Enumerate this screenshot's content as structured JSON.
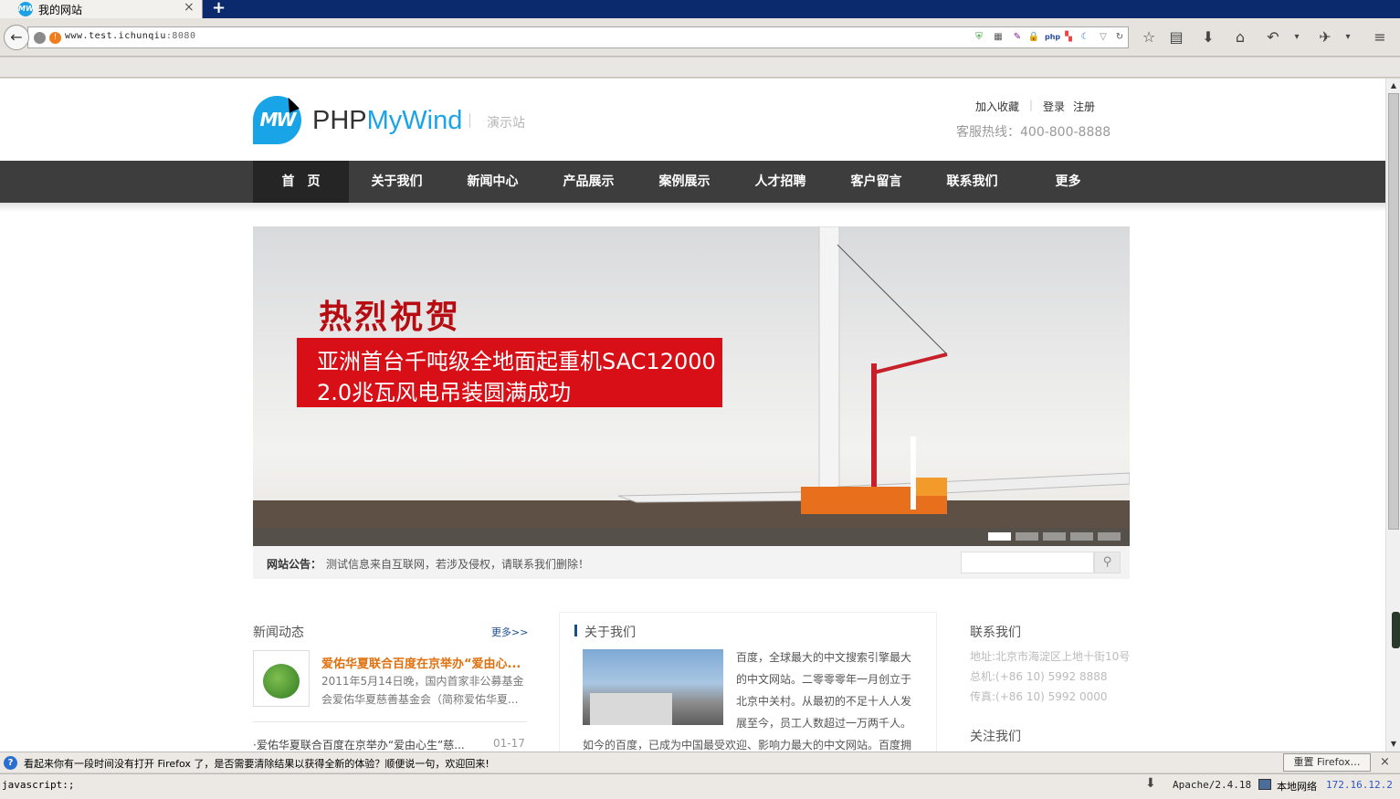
{
  "browser": {
    "tab_title": "我的网站",
    "tab_close": "×",
    "new_tab": "+",
    "url_host": "www.test.ichunqiu",
    "url_port": ":8080",
    "back": "←"
  },
  "site": {
    "logo_mark": "MW",
    "logo_php": "PHP",
    "logo_mywind": "MyWind",
    "logo_demo": "演示站",
    "top_links": [
      "加入收藏",
      "登录",
      "注册"
    ],
    "hotline": "客服热线：400-800-8888"
  },
  "nav": [
    "首　页",
    "关于我们",
    "新闻中心",
    "产品展示",
    "案例展示",
    "人才招聘",
    "客户留言",
    "联系我们",
    "更多"
  ],
  "banner": {
    "headline": "热烈祝贺",
    "line1": "亚洲首台千吨级全地面起重机SAC12000",
    "line2": "2.0兆瓦风电吊装圆满成功",
    "slide_count": 5,
    "active_slide": 1
  },
  "notice": {
    "label": "网站公告：",
    "text": "测试信息来自互联网，若涉及侵权，请联系我们删除！",
    "search_placeholder": ""
  },
  "news": {
    "title": "新闻动态",
    "more": "更多>>",
    "featured_title": "爱佑华夏联合百度在京举办“爱由心...",
    "featured_desc_1": "2011年5月14日晚，国内首家非公募基金",
    "featured_desc_2": "会爱佑华夏慈善基金会（简称爱佑华夏...",
    "items": [
      {
        "title": "·爱佑华夏联合百度在京举办“爱由心生”慈...",
        "date": "01-17"
      }
    ]
  },
  "about": {
    "title": "关于我们",
    "lines": [
      "百度，全球最大的中文搜索引擎最大",
      "的中文网站。二零零零年一月创立于",
      "北京中关村。从最初的不足十人人发",
      "展至今，员工人数超过一万两千人。"
    ],
    "line_full": "如今的百度，已成为中国最受欢迎、影响力最大的中文网站。百度拥"
  },
  "contact": {
    "title": "联系我们",
    "address": "地址:北京市海淀区上地十街10号",
    "phone": "总机:(+86 10) 5992 8888",
    "fax": "传真:(+86 10) 5992 0000",
    "follow": "关注我们"
  },
  "notification": {
    "message": "看起来你有一段时间没有打开 Firefox 了，是否需要清除结果以获得全新的体验？顺便说一句，欢迎回来!",
    "reset_button": "重置 Firefox…",
    "close": "×"
  },
  "statusbar": {
    "left": "javascript:;",
    "server": "Apache/2.4.18",
    "network": "本地网络",
    "ip": "172.16.12.2"
  },
  "colors": {
    "brand_blue": "#1aa4e8",
    "nav_bg": "#3d3d3d",
    "banner_red": "#d90f17",
    "news_orange": "#e0700e"
  }
}
